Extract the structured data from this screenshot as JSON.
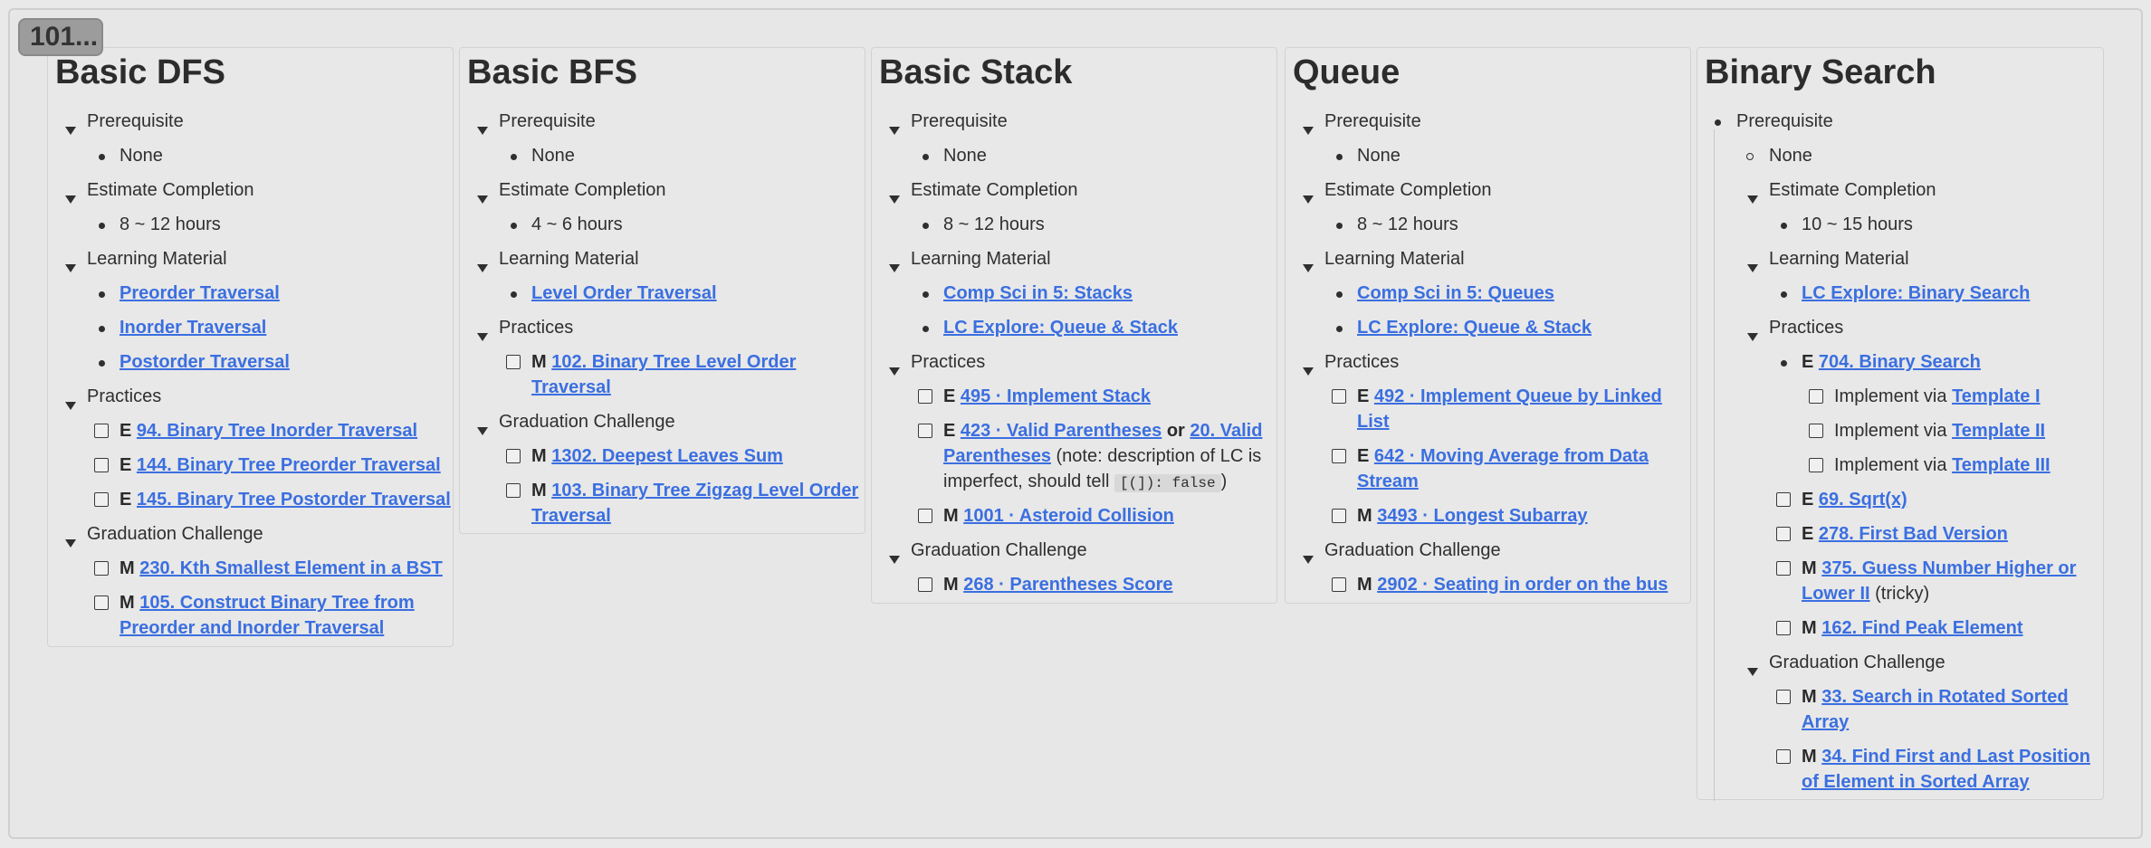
{
  "tag": "101...",
  "columns": [
    {
      "title": "Basic DFS",
      "prereq_label": "Prerequisite",
      "prereq_value": "None",
      "est_label": "Estimate Completion",
      "est_value": "8 ~ 12 hours",
      "material_label": "Learning Material",
      "materials": [
        "Preorder Traversal",
        "Inorder Traversal",
        "Postorder Traversal"
      ],
      "practices_label": "Practices",
      "practices": [
        {
          "d": "E",
          "t": "94. Binary Tree Inorder Traversal"
        },
        {
          "d": "E",
          "t": "144. Binary Tree Preorder Traversal"
        },
        {
          "d": "E",
          "t": "145. Binary Tree Postorder Traversal"
        }
      ],
      "grad_label": "Graduation Challenge",
      "grad": [
        {
          "d": "M",
          "t": "230. Kth Smallest Element in a BST"
        },
        {
          "d": "M",
          "t1": "105. Construct Binary Tree from",
          "t2": "Preorder and Inorder Traversal"
        }
      ]
    },
    {
      "title": "Basic BFS",
      "prereq_label": "Prerequisite",
      "prereq_value": "None",
      "est_label": "Estimate Completion",
      "est_value": "4 ~ 6 hours",
      "material_label": "Learning Material",
      "materials": [
        "Level Order Traversal"
      ],
      "practices_label": "Practices",
      "practices": [
        {
          "d": "M",
          "t1": "102. Binary Tree Level Order",
          "t2": "Traversal"
        }
      ],
      "grad_label": "Graduation Challenge",
      "grad": [
        {
          "d": "M",
          "t": "1302. Deepest Leaves Sum"
        },
        {
          "d": "M",
          "t1": "103. Binary Tree Zigzag Level Order",
          "t2": "Traversal"
        }
      ]
    },
    {
      "title": "Basic Stack",
      "prereq_label": "Prerequisite",
      "prereq_value": "None",
      "est_label": "Estimate Completion",
      "est_value": "8 ~ 12 hours",
      "material_label": "Learning Material",
      "materials": [
        "Comp Sci in 5: Stacks",
        "LC Explore: Queue & Stack"
      ],
      "practices_label": "Practices",
      "p1": {
        "d": "E",
        "t": "495 · Implement Stack"
      },
      "p2": {
        "d": "E",
        "a": "423 · Valid Parentheses",
        "or": "or",
        "b1": "20. Valid",
        "b2": "Parentheses",
        "note1": " (note: description of LC is",
        "note2": "imperfect, should tell ",
        "code": "[(]): false",
        "close": ")"
      },
      "p3": {
        "d": "M",
        "t": "1001 · Asteroid Collision"
      },
      "grad_label": "Graduation Challenge",
      "grad": [
        {
          "d": "M",
          "t": "268 · Parentheses Score"
        }
      ]
    },
    {
      "title": "Queue",
      "prereq_label": "Prerequisite",
      "prereq_value": "None",
      "est_label": "Estimate Completion",
      "est_value": "8 ~ 12 hours",
      "material_label": "Learning Material",
      "materials": [
        "Comp Sci in 5: Queues",
        "LC Explore: Queue & Stack"
      ],
      "practices_label": "Practices",
      "practices": [
        {
          "d": "E",
          "t1": "492 · Implement Queue by Linked",
          "t2": "List"
        },
        {
          "d": "E",
          "t1": "642 · Moving Average from Data",
          "t2": "Stream"
        },
        {
          "d": "M",
          "t": "3493 · Longest Subarray"
        }
      ],
      "grad_label": "Graduation Challenge",
      "grad": [
        {
          "d": "M",
          "t": "2902 · Seating in order on the bus"
        }
      ]
    },
    {
      "title": "Binary Search",
      "prereq_label": "Prerequisite",
      "prereq_value": "None",
      "est_label": "Estimate Completion",
      "est_value": "10 ~ 15 hours",
      "material_label": "Learning Material",
      "materials": [
        "LC Explore: Binary Search"
      ],
      "practices_label": "Practices",
      "p704": {
        "d": "E",
        "t": "704. Binary Search"
      },
      "impl_label": "Implement via",
      "templates": [
        "Template I",
        "Template II",
        "Template III"
      ],
      "more": [
        {
          "d": "E",
          "t": "69. Sqrt(x)"
        },
        {
          "d": "E",
          "t": "278. First Bad Version"
        }
      ],
      "p375": {
        "d": "M",
        "t1": "375. Guess Number Higher or",
        "t2": "Lower II",
        "suffix": " (tricky)"
      },
      "p162": {
        "d": "M",
        "t": "162. Find Peak Element"
      },
      "grad_label": "Graduation Challenge",
      "grad": [
        {
          "d": "M",
          "t1": "33. Search in Rotated Sorted",
          "t2": "Array"
        },
        {
          "d": "M",
          "t1": "34. Find First and Last Position",
          "t2": "of Element in Sorted Array"
        }
      ]
    }
  ]
}
